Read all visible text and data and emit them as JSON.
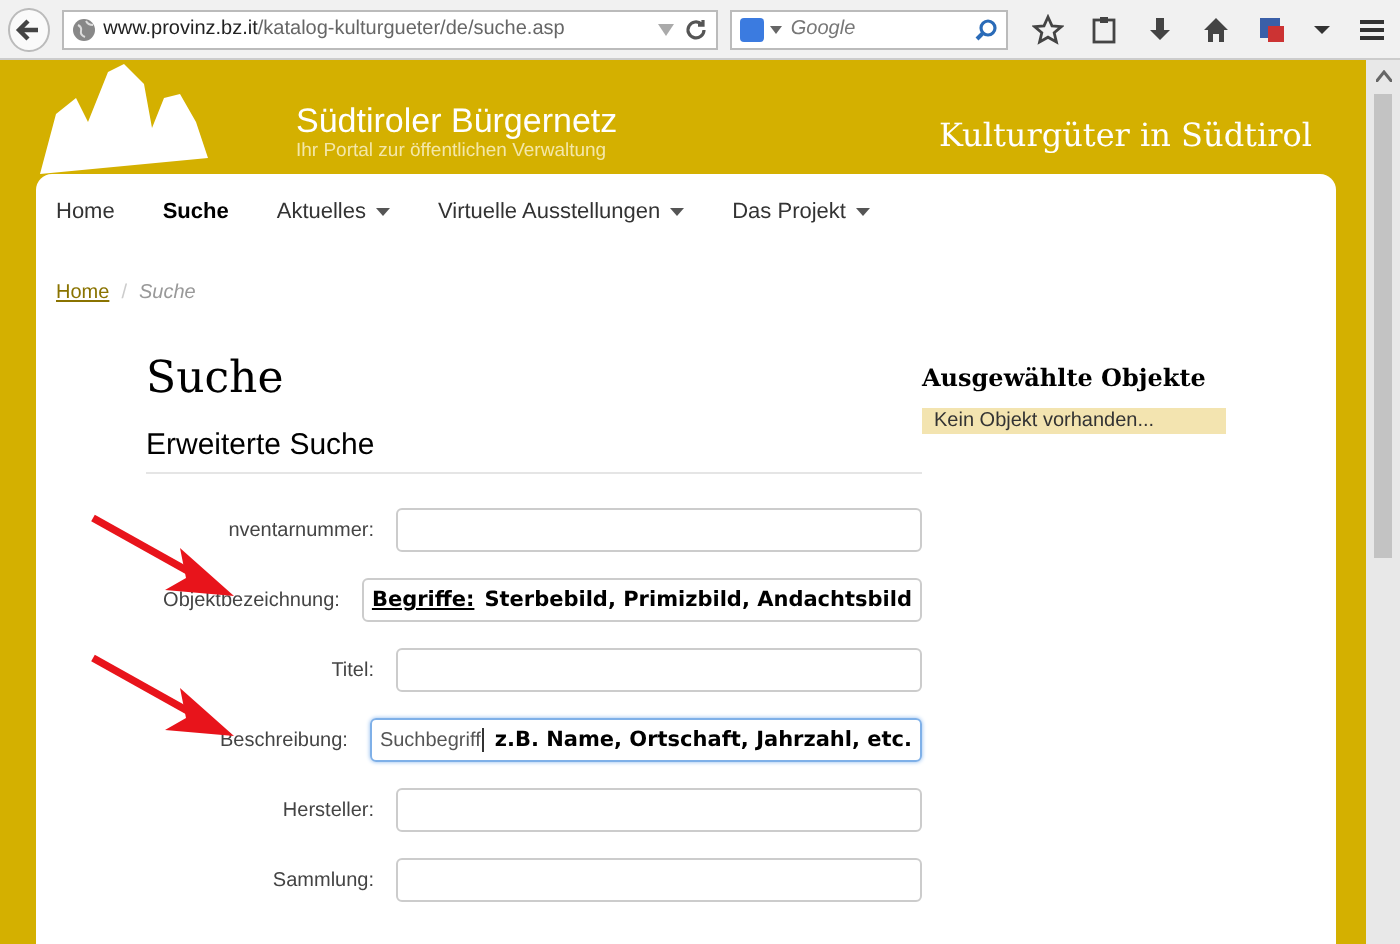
{
  "browser": {
    "url_host": "www.provinz.bz.it",
    "url_path": "/katalog-kulturgueter/de/suche.asp",
    "search_placeholder": "Google"
  },
  "header": {
    "brand": "Südtiroler Bürgernetz",
    "tagline": "Ihr Portal zur öffentlichen Verwaltung",
    "site_title": "Kulturgüter in Südtirol"
  },
  "nav": [
    {
      "label": "Home",
      "selected": false,
      "dropdown": false
    },
    {
      "label": "Suche",
      "selected": true,
      "dropdown": false
    },
    {
      "label": "Aktuelles",
      "selected": false,
      "dropdown": true
    },
    {
      "label": "Virtuelle Ausstellungen",
      "selected": false,
      "dropdown": true
    },
    {
      "label": "Das Projekt",
      "selected": false,
      "dropdown": true
    }
  ],
  "breadcrumb": {
    "separator": "/",
    "items": [
      "Home",
      "Suche"
    ]
  },
  "title": "Suche",
  "subtitle": "Erweiterte Suche",
  "fields": [
    {
      "label": "nventarnummer:",
      "focused": false,
      "arrow": false
    },
    {
      "label": "Objektbezeichnung:",
      "focused": false,
      "arrow": true,
      "note_label": "Begriffe:",
      "note": "Sterbebild, Primizbild, Andachtsbild"
    },
    {
      "label": "Titel:",
      "focused": false,
      "arrow": false
    },
    {
      "label": "Beschreibung:",
      "focused": true,
      "arrow": true,
      "value": "Suchbegriff",
      "note": "z.B. Name, Ortschaft, Jahrzahl, etc."
    },
    {
      "label": "Hersteller:",
      "focused": false,
      "arrow": false
    },
    {
      "label": "Sammlung:",
      "focused": false,
      "arrow": false
    }
  ],
  "sidebar": {
    "title": "Ausgewählte Objekte",
    "empty": "Kein Objekt vorhanden..."
  }
}
